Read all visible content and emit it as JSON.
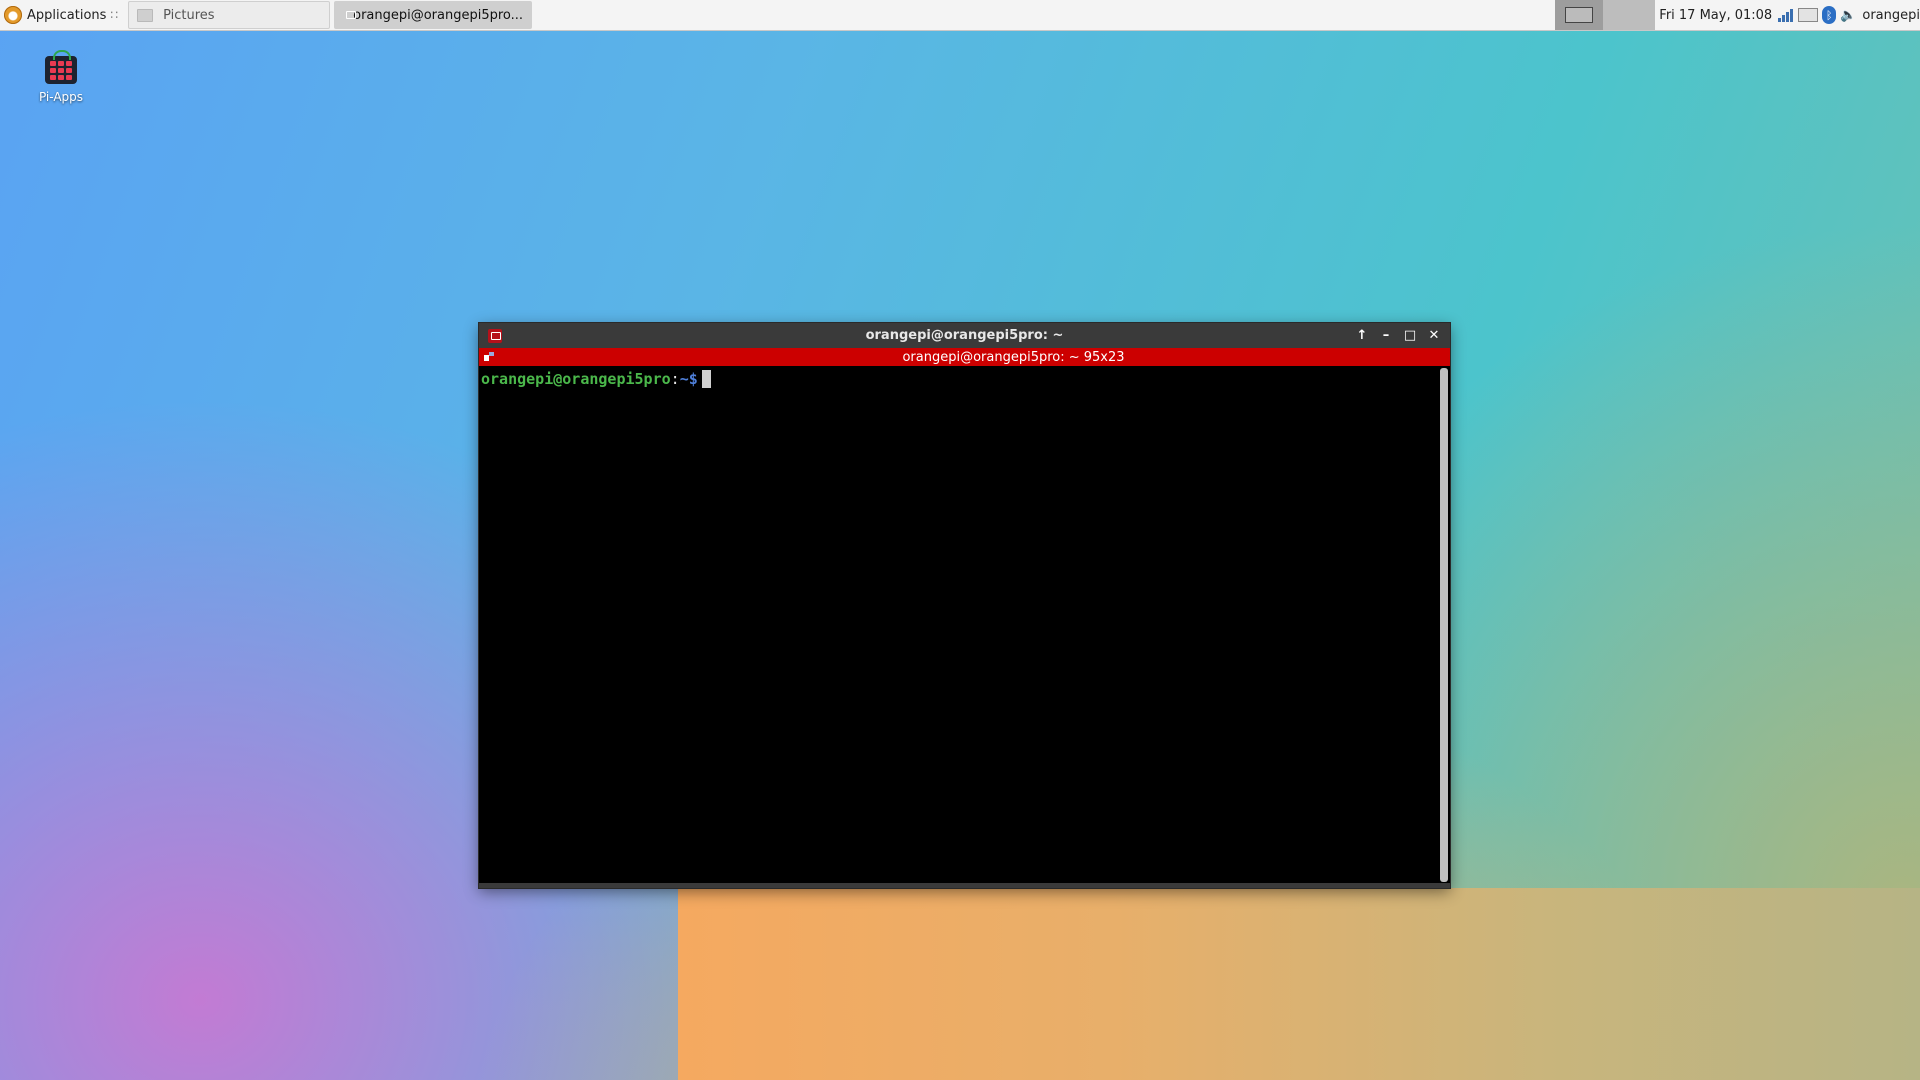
{
  "panel": {
    "applications_label": "Applications",
    "menu_separator": "∷",
    "tasks": [
      {
        "label": "Pictures"
      },
      {
        "label": "orangepi@orangepi5pro..."
      }
    ],
    "clock": "Fri 17 May, 01:08",
    "user": "orangepi"
  },
  "desktop": {
    "icons": [
      {
        "label": "Pi-Apps"
      }
    ]
  },
  "terminal": {
    "window_title": "orangepi@orangepi5pro: ~",
    "tab_title": "orangepi@orangepi5pro: ~ 95x23",
    "prompt_user": "orangepi@orangepi5pro",
    "prompt_sep": ":",
    "prompt_path": "~$",
    "buttons": {
      "up": "↑",
      "minimize": "–",
      "maximize": "□",
      "close": "✕"
    }
  },
  "colors": {
    "terminal_tab_bar": "#cc0000",
    "prompt_user": "#4bb84b",
    "prompt_path": "#4e7fd9"
  }
}
